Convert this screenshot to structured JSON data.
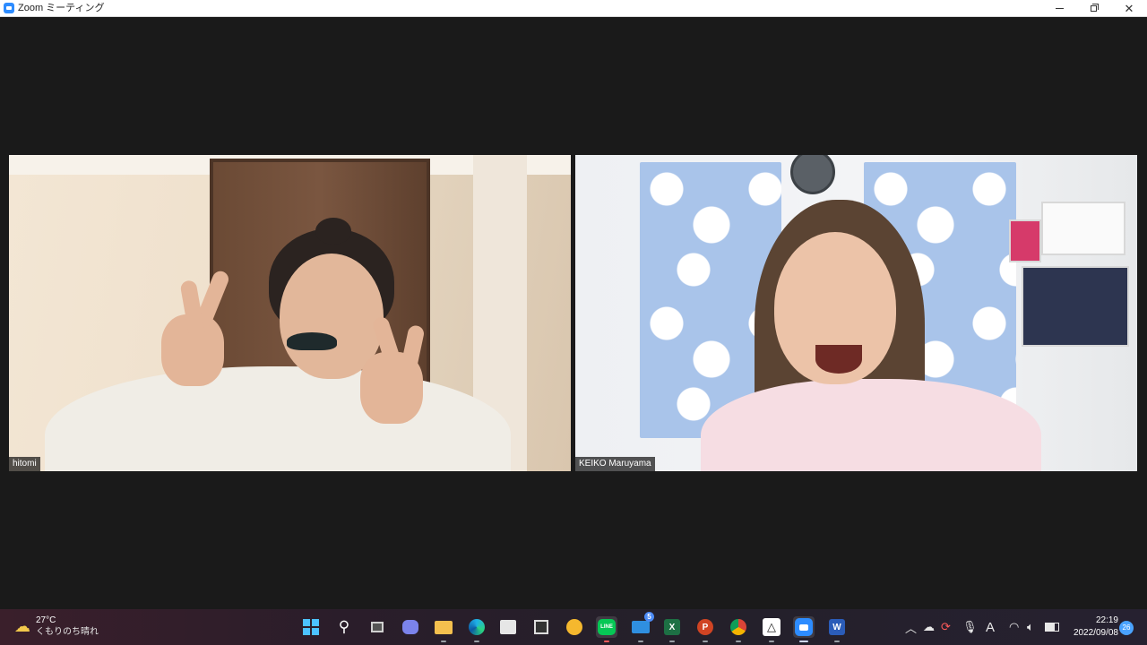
{
  "window": {
    "title": "Zoom ミーティング",
    "app_icon": "zoom-icon",
    "controls": {
      "minimize": "minimize-icon",
      "maximize": "maximize-icon",
      "close": "✕"
    }
  },
  "participants": [
    {
      "name": "hitomi",
      "accent": "#e9dccb"
    },
    {
      "name": "KEIKO Maruyama",
      "accent": "#a9c4ea"
    }
  ],
  "taskbar": {
    "weather": {
      "temp": "27°C",
      "desc": "くもりのち晴れ",
      "icon": "partly-cloudy-icon"
    },
    "apps": [
      {
        "name": "start-icon",
        "active": false
      },
      {
        "name": "search-icon",
        "active": false
      },
      {
        "name": "task-view-icon",
        "active": false
      },
      {
        "name": "teams-chat-icon",
        "active": false
      },
      {
        "name": "file-explorer-icon",
        "active": false
      },
      {
        "name": "edge-icon",
        "active": false
      },
      {
        "name": "store-icon",
        "active": false
      },
      {
        "name": "photos-icon",
        "active": false
      },
      {
        "name": "app-yellow-icon",
        "active": false
      },
      {
        "name": "line-icon",
        "label": "LINE",
        "active": true
      },
      {
        "name": "mail-icon",
        "badge": "5",
        "active": false
      },
      {
        "name": "excel-icon",
        "label": "X",
        "active": false
      },
      {
        "name": "powerpoint-icon",
        "label": "P",
        "active": false
      },
      {
        "name": "chrome-icon",
        "active": false
      },
      {
        "name": "app-triangle-icon",
        "active": false
      },
      {
        "name": "zoom-app-icon",
        "active": true
      },
      {
        "name": "word-icon",
        "label": "W",
        "active": false
      }
    ],
    "tray": {
      "ime": "A",
      "time": "22:19",
      "date": "2022/09/08",
      "notifications": "26"
    }
  }
}
